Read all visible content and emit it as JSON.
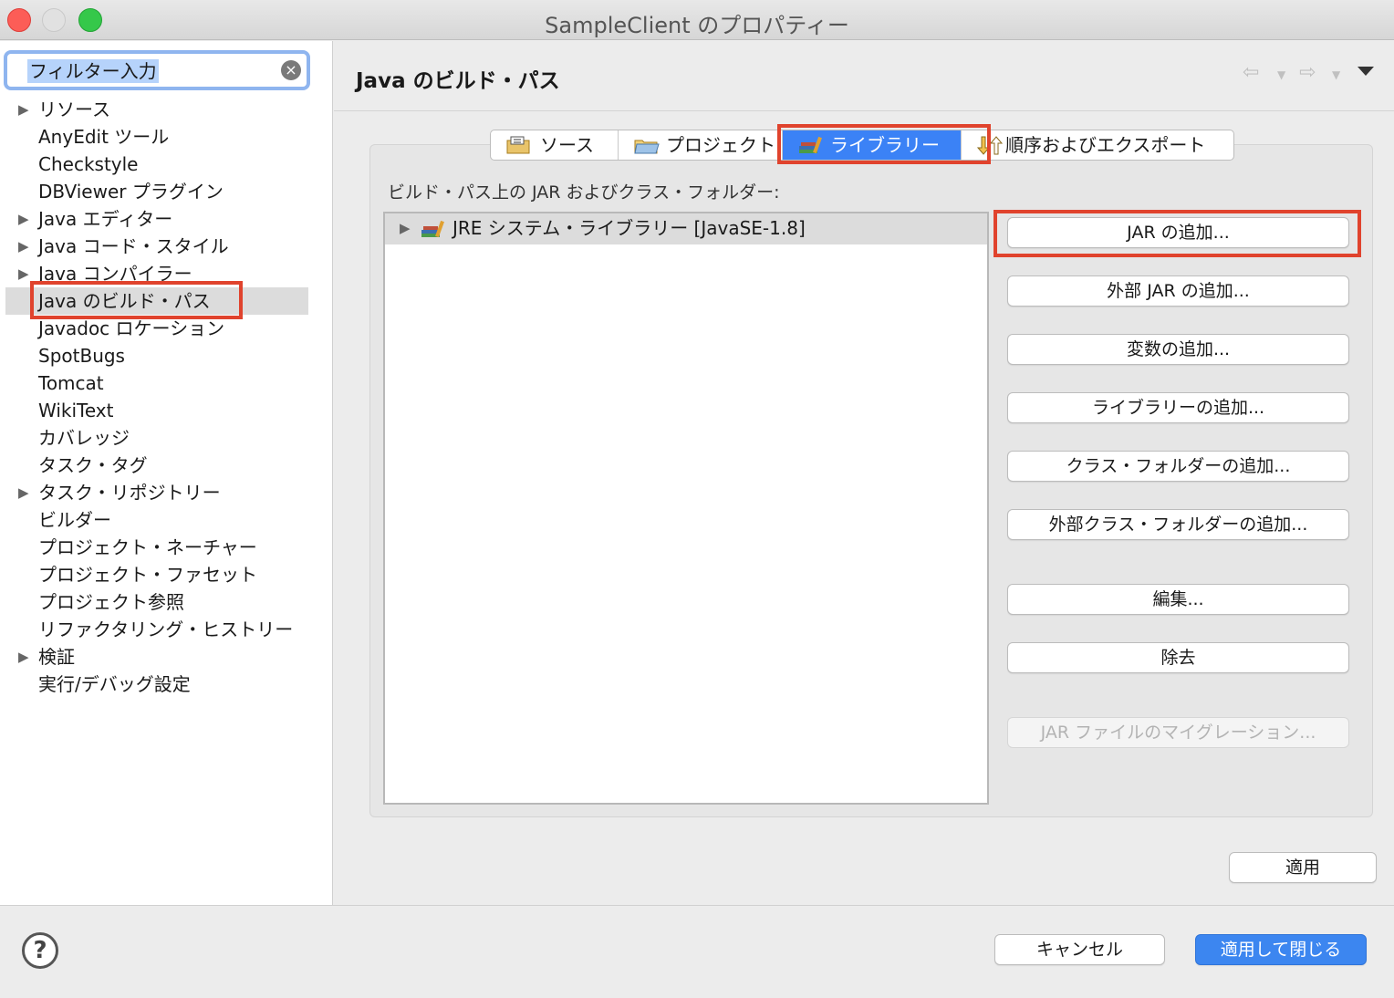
{
  "window": {
    "title": "SampleClient のプロパティー"
  },
  "filter": {
    "value": "フィルター入力",
    "clear_icon": "clear-icon"
  },
  "tree": [
    {
      "label": "リソース",
      "expandable": true
    },
    {
      "label": "AnyEdit ツール",
      "expandable": false
    },
    {
      "label": "Checkstyle",
      "expandable": false
    },
    {
      "label": "DBViewer プラグイン",
      "expandable": false
    },
    {
      "label": "Java エディター",
      "expandable": true
    },
    {
      "label": "Java コード・スタイル",
      "expandable": true
    },
    {
      "label": "Java コンパイラー",
      "expandable": true
    },
    {
      "label": "Java のビルド・パス",
      "expandable": false,
      "selected": true
    },
    {
      "label": "Javadoc ロケーション",
      "expandable": false
    },
    {
      "label": "SpotBugs",
      "expandable": false
    },
    {
      "label": "Tomcat",
      "expandable": false
    },
    {
      "label": "WikiText",
      "expandable": false
    },
    {
      "label": "カバレッジ",
      "expandable": false
    },
    {
      "label": "タスク・タグ",
      "expandable": false
    },
    {
      "label": "タスク・リポジトリー",
      "expandable": true
    },
    {
      "label": "ビルダー",
      "expandable": false
    },
    {
      "label": "プロジェクト・ネーチャー",
      "expandable": false
    },
    {
      "label": "プロジェクト・ファセット",
      "expandable": false
    },
    {
      "label": "プロジェクト参照",
      "expandable": false
    },
    {
      "label": "リファクタリング・ヒストリー",
      "expandable": false
    },
    {
      "label": "検証",
      "expandable": true
    },
    {
      "label": "実行/デバッグ設定",
      "expandable": false
    }
  ],
  "header": {
    "title": "Java のビルド・パス"
  },
  "tabs": [
    {
      "label": "ソース",
      "active": false
    },
    {
      "label": "プロジェクト",
      "active": false
    },
    {
      "label": "ライブラリー",
      "active": true
    },
    {
      "label": "順序およびエクスポート",
      "active": false
    }
  ],
  "library": {
    "caption": "ビルド・パス上の JAR およびクラス・フォルダー:",
    "items": [
      {
        "label": "JRE システム・ライブラリー [JavaSE-1.8]"
      }
    ]
  },
  "buttons": {
    "add_jar": "JAR の追加...",
    "add_external_jar": "外部 JAR の追加...",
    "add_variable": "変数の追加...",
    "add_library": "ライブラリーの追加...",
    "add_class_folder": "クラス・フォルダーの追加...",
    "add_external_class_folder": "外部クラス・フォルダーの追加...",
    "edit": "編集...",
    "remove": "除去",
    "migrate_jar": "JAR ファイルのマイグレーション...",
    "apply": "適用",
    "cancel": "キャンセル",
    "apply_close": "適用して閉じる"
  },
  "colors": {
    "accent": "#3b82f6",
    "highlight": "#e0432d",
    "selection": "#dcdcdc"
  }
}
